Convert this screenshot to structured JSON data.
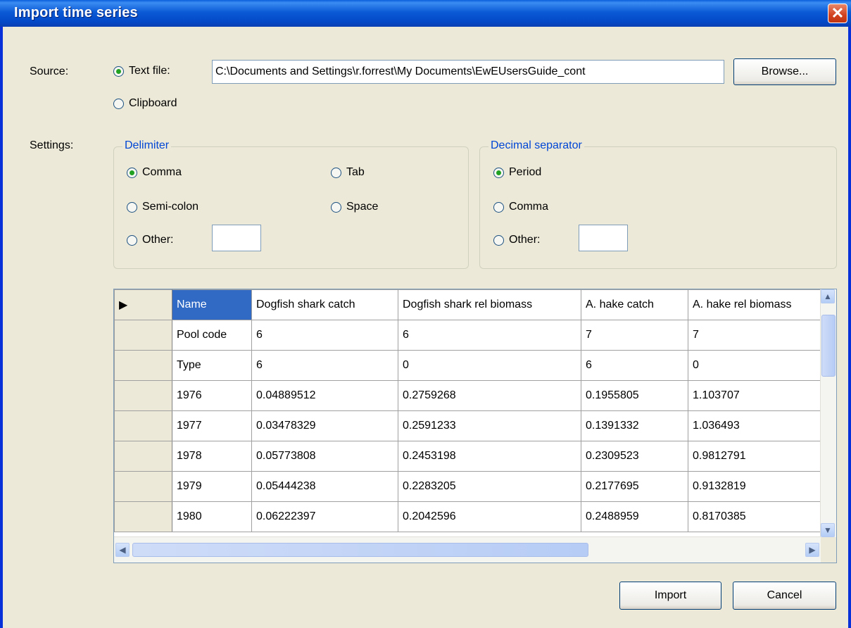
{
  "window": {
    "title": "Import time series",
    "close_glyph": "✕"
  },
  "source": {
    "label": "Source:",
    "text_file_label": "Text file:",
    "text_file_path": "C:\\Documents and Settings\\r.forrest\\My Documents\\EwEUsersGuide_cont",
    "browse_label": "Browse...",
    "clipboard_label": "Clipboard",
    "selected": "text_file"
  },
  "settings": {
    "label": "Settings:",
    "delimiter": {
      "title": "Delimiter",
      "options": [
        "Comma",
        "Tab",
        "Semi-colon",
        "Space",
        "Other:"
      ],
      "selected": "Comma",
      "other_value": ""
    },
    "decimal": {
      "title": "Decimal separator",
      "options": [
        "Period",
        "Comma",
        "Other:"
      ],
      "selected": "Period",
      "other_value": ""
    }
  },
  "grid": {
    "columns": [
      "Name",
      "Dogfish shark catch",
      "Dogfish shark rel biomass",
      "A. hake catch",
      "A. hake rel biomass"
    ],
    "rows": [
      [
        "Pool code",
        "6",
        "6",
        "7",
        "7"
      ],
      [
        "Type",
        "6",
        "0",
        "6",
        "0"
      ],
      [
        "1976",
        "0.04889512",
        "0.2759268",
        "0.1955805",
        "1.103707"
      ],
      [
        "1977",
        "0.03478329",
        "0.2591233",
        "0.1391332",
        "1.036493"
      ],
      [
        "1978",
        "0.05773808",
        "0.2453198",
        "0.2309523",
        "0.9812791"
      ],
      [
        "1979",
        "0.05444238",
        "0.2283205",
        "0.2177695",
        "0.9132819"
      ],
      [
        "1980",
        "0.06222397",
        "0.2042596",
        "0.2488959",
        "0.8170385"
      ]
    ],
    "current_row_marker": "▶"
  },
  "buttons": {
    "import_label": "Import",
    "cancel_label": "Cancel"
  },
  "colors": {
    "titlebar": "#0a5fdb",
    "selection": "#316ac5",
    "group_title": "#0046d5",
    "face": "#ece9d8"
  }
}
